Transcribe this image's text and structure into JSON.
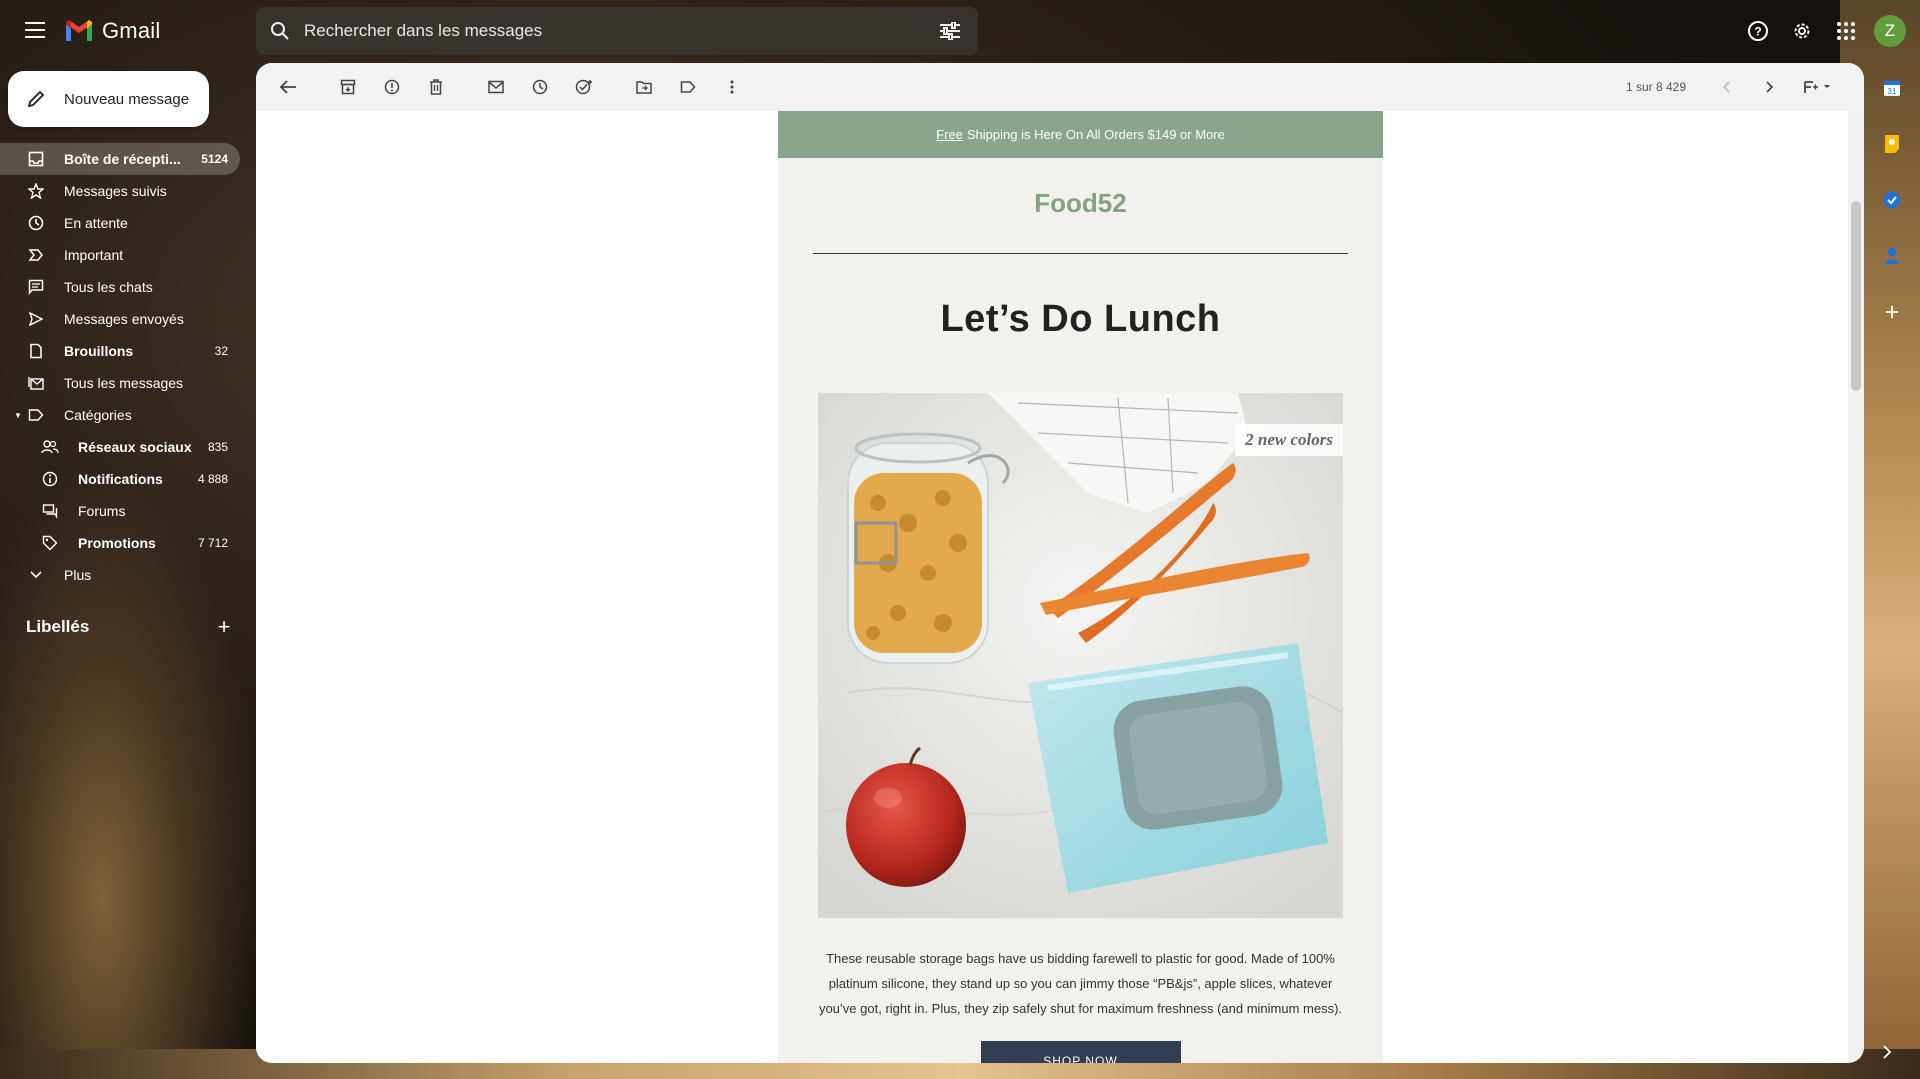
{
  "app": {
    "name": "Gmail"
  },
  "search": {
    "placeholder": "Rechercher dans les messages"
  },
  "account": {
    "initial": "Z"
  },
  "compose": {
    "label": "Nouveau message"
  },
  "sidebar": {
    "items": [
      {
        "label": "Boîte de récepti...",
        "count": "5124",
        "icon": "inbox-icon"
      },
      {
        "label": "Messages suivis",
        "count": "",
        "icon": "star-icon"
      },
      {
        "label": "En attente",
        "count": "",
        "icon": "clock-icon"
      },
      {
        "label": "Important",
        "count": "",
        "icon": "important-icon"
      },
      {
        "label": "Tous les chats",
        "count": "",
        "icon": "chat-icon"
      },
      {
        "label": "Messages envoyés",
        "count": "",
        "icon": "send-icon"
      },
      {
        "label": "Brouillons",
        "count": "32",
        "icon": "draft-icon"
      },
      {
        "label": "Tous les messages",
        "count": "",
        "icon": "all-mail-icon"
      },
      {
        "label": "Catégories",
        "count": "",
        "icon": "label-icon"
      },
      {
        "label": "Réseaux sociaux",
        "count": "835",
        "icon": "people-icon"
      },
      {
        "label": "Notifications",
        "count": "4 888",
        "icon": "info-icon"
      },
      {
        "label": "Forums",
        "count": "",
        "icon": "forum-icon"
      },
      {
        "label": "Promotions",
        "count": "7 712",
        "icon": "tag-icon"
      },
      {
        "label": "Plus",
        "count": "",
        "icon": "chevron-down-icon"
      }
    ],
    "labels_title": "Libellés",
    "labels_add": "+"
  },
  "toolbar": {
    "pager": "1 sur 8 429"
  },
  "email": {
    "banner_link": "Free",
    "banner_text": "Shipping is Here On All Orders $149 or More",
    "brand": "Food52",
    "headline": "Let’s Do Lunch",
    "image_badge": "2 new colors",
    "body": "These reusable storage bags have us bidding farewell to plastic for good. Made of 100% platinum silicone, they stand up so you can jimmy those “PB&js”, apple slices, whatever you’ve got, right in. Plus, they zip safely shut for maximum freshness (and minimum mess).",
    "cta": "SHOP NOW"
  },
  "colors": {
    "brand_green": "#86a284",
    "banner_green": "#89a68a",
    "cta_navy": "#2f3e52",
    "avatar_green": "#5f9e3a"
  }
}
